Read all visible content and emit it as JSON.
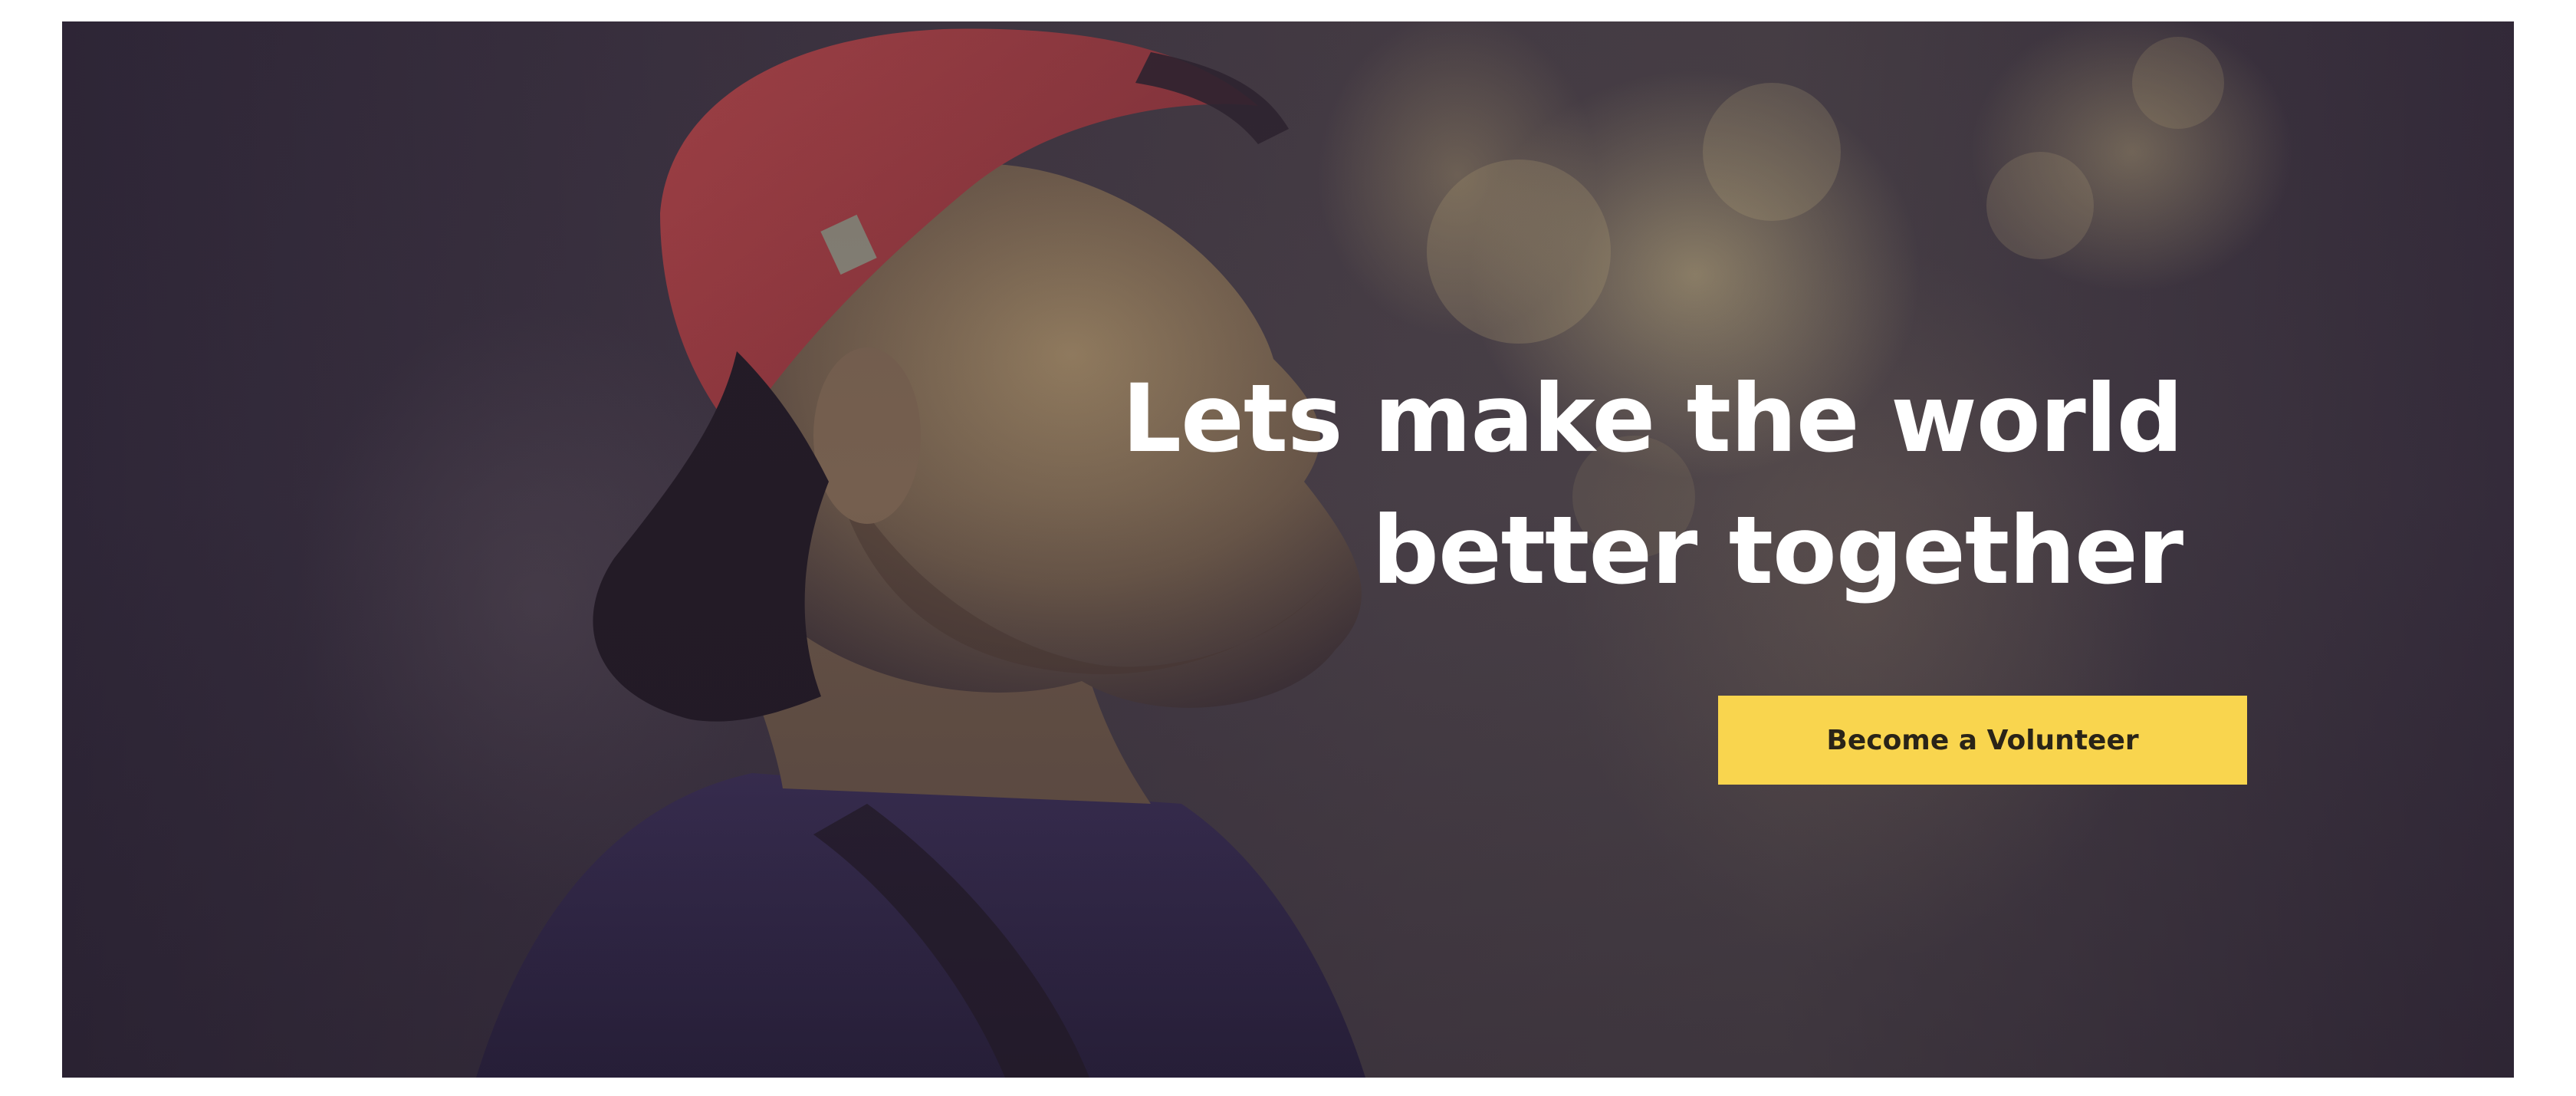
{
  "hero": {
    "headline": "Lets make the world better together",
    "cta_label": "Become a Volunteer"
  },
  "colors": {
    "cta_background": "#f9d54e",
    "cta_text": "#2a2418",
    "headline_text": "#ffffff",
    "overlay_tint": "#2f2738"
  },
  "image": {
    "subject": "young man wearing a backwards red cap looking upward"
  }
}
